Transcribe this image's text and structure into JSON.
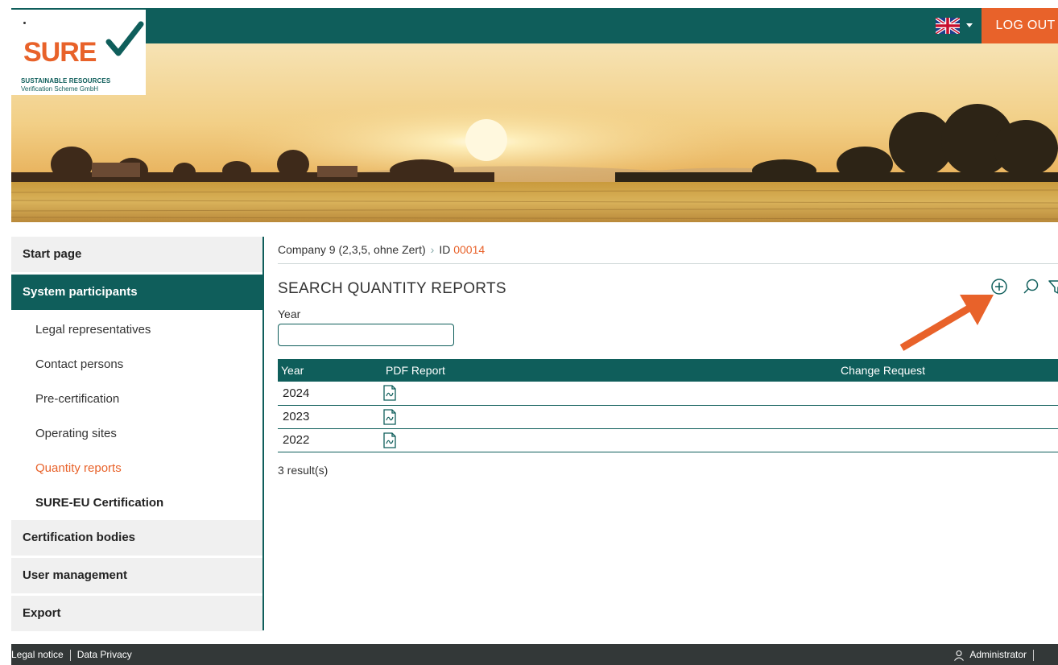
{
  "header": {
    "logout_label": "LOG OUT",
    "language_flag": "uk-flag-icon",
    "logo": {
      "word": "SURE",
      "line1": "SUSTAINABLE RESOURCES",
      "line2": "Verification Scheme GmbH"
    }
  },
  "sidebar": {
    "items": [
      {
        "label": "Start page"
      },
      {
        "label": "System participants"
      },
      {
        "label": "Legal representatives"
      },
      {
        "label": "Contact persons"
      },
      {
        "label": "Pre-certification"
      },
      {
        "label": "Operating sites"
      },
      {
        "label": "Quantity reports"
      },
      {
        "label": "SURE-EU Certification"
      },
      {
        "label": "Certification bodies"
      },
      {
        "label": "User management"
      },
      {
        "label": "Export"
      }
    ]
  },
  "main": {
    "breadcrumb": {
      "company": "Company 9 (2,3,5, ohne Zert)",
      "id_label": "ID",
      "id_value": "00014"
    },
    "title": "SEARCH QUANTITY REPORTS",
    "filter": {
      "year_label": "Year",
      "year_value": ""
    },
    "table": {
      "columns": [
        "Year",
        "PDF Report",
        "Change Request"
      ],
      "rows": [
        {
          "year": "2024",
          "pdf": "pdf-report-icon",
          "change_request": ""
        },
        {
          "year": "2023",
          "pdf": "pdf-report-icon",
          "change_request": ""
        },
        {
          "year": "2022",
          "pdf": "pdf-report-icon",
          "change_request": ""
        }
      ]
    },
    "result_count": "3 result(s)"
  },
  "footer": {
    "legal_notice": "Legal notice",
    "data_privacy": "Data Privacy",
    "user": "Administrator"
  },
  "colors": {
    "brand_teal": "#0f5e5b",
    "accent_orange": "#e8622a",
    "footer_dark": "#333838"
  }
}
